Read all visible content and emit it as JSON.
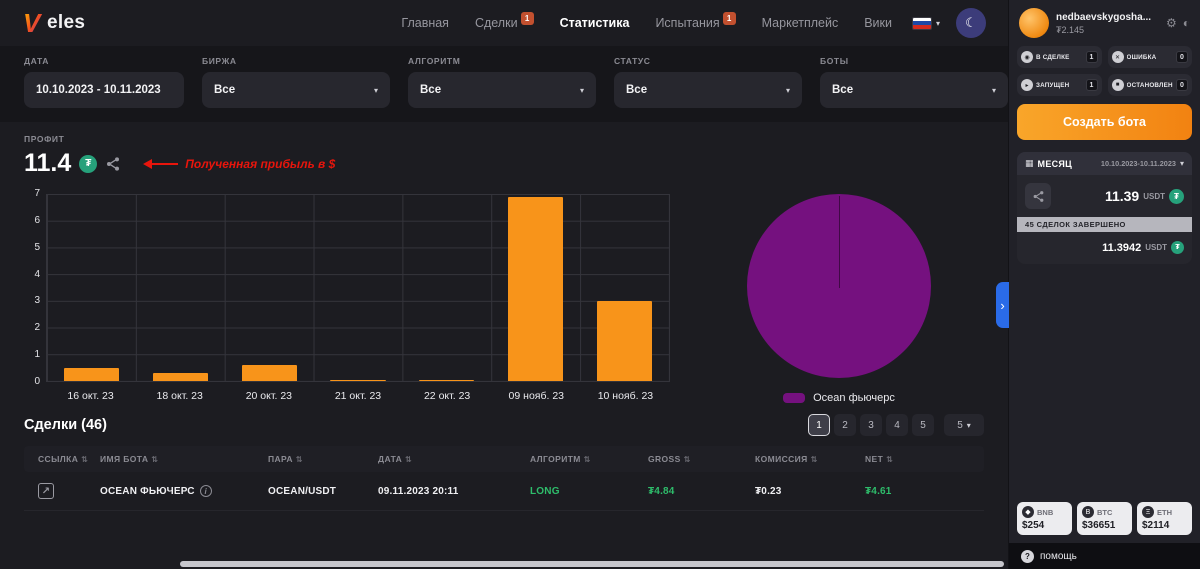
{
  "logo": {
    "mark": "V",
    "text": "eles"
  },
  "nav": {
    "items": [
      {
        "label": "Главная",
        "badge": ""
      },
      {
        "label": "Сделки",
        "badge": "1"
      },
      {
        "label": "Статистика",
        "badge": ""
      },
      {
        "label": "Испытания",
        "badge": "1"
      },
      {
        "label": "Маркетплейс",
        "badge": ""
      },
      {
        "label": "Вики",
        "badge": ""
      }
    ]
  },
  "filters": {
    "date": {
      "label": "ДАТА",
      "value": "10.10.2023 - 10.11.2023"
    },
    "exchange": {
      "label": "БИРЖА",
      "value": "Все"
    },
    "algorithm": {
      "label": "АЛГОРИТМ",
      "value": "Все"
    },
    "status": {
      "label": "СТАТУС",
      "value": "Все"
    },
    "bots": {
      "label": "БОТЫ",
      "value": "Все"
    }
  },
  "profit": {
    "label": "ПРОФИТ",
    "value": "11.4",
    "annotation": "Полученная прибыль в $"
  },
  "chart_data": [
    {
      "type": "bar",
      "categories": [
        "16 окт. 23",
        "18 окт. 23",
        "20 окт. 23",
        "21 окт. 23",
        "22 окт. 23",
        "09 нояб. 23",
        "10 нояб. 23"
      ],
      "values": [
        0.5,
        0.3,
        0.6,
        0.05,
        0.05,
        6.9,
        3.0
      ],
      "ylim": [
        0,
        7
      ],
      "yticks": [
        0,
        1,
        2,
        3,
        4,
        5,
        6,
        7
      ],
      "bar_color": "#f8941a",
      "grid": true,
      "title": "",
      "xlabel": "",
      "ylabel": ""
    },
    {
      "type": "pie",
      "slices": [
        {
          "label": "Ocean фьючерс",
          "value": 100,
          "color": "#75117f"
        }
      ],
      "legend_position": "bottom"
    }
  ],
  "trades": {
    "title": "Сделки (46)",
    "pagination": {
      "pages": [
        "1",
        "2",
        "3",
        "4",
        "5"
      ],
      "active_page": "1",
      "page_size": "5"
    },
    "columns": [
      "ССЫЛКА",
      "ИМЯ БОТА",
      "ПАРА",
      "ДАТА",
      "АЛГОРИТМ",
      "GROSS",
      "КОМИССИЯ",
      "NET"
    ],
    "rows": [
      {
        "bot_name": "OCEAN ФЬЮЧЕРС",
        "pair": "OCEAN/USDT",
        "date": "09.11.2023 20:11",
        "algorithm": "LONG",
        "gross": "₮4.84",
        "commission": "₮0.23",
        "net": "₮4.61"
      }
    ]
  },
  "sidebar": {
    "user": {
      "name": "nedbaevskygosha...",
      "balance": "₮2.145"
    },
    "chips": [
      {
        "label": "В СДЕЛКЕ",
        "count": "1",
        "icon": "◉"
      },
      {
        "label": "ОШИБКА",
        "count": "0",
        "icon": "✕"
      },
      {
        "label": "ЗАПУЩЕН",
        "count": "1",
        "icon": "▸"
      },
      {
        "label": "ОСТАНОВЛЕН",
        "count": "0",
        "icon": "■"
      }
    ],
    "create_bot_label": "Создать бота",
    "period": {
      "label": "МЕСЯЦ",
      "value": "10.10.2023-10.11.2023"
    },
    "summary": {
      "profit": "11.39",
      "currency": "USDT",
      "deals_done": "45 СДЕЛОК ЗАВЕРШЕНО",
      "net": "11.3942"
    },
    "tickers": [
      {
        "symbol": "BNB",
        "price": "$254",
        "glyph": "◆"
      },
      {
        "symbol": "BTC",
        "price": "$36651",
        "glyph": "B"
      },
      {
        "symbol": "ETH",
        "price": "$2114",
        "glyph": "Ξ"
      }
    ],
    "help_label": "помощь"
  },
  "icons": {
    "refresh": "↻",
    "gear": "⚙",
    "brightness": "◐",
    "moon": "☾",
    "caret": "▾",
    "sort": "⇅",
    "chevron_right": "›",
    "calendar": "▦",
    "info": "i",
    "external_link": "↗",
    "usdt": "₮",
    "help": "?"
  }
}
